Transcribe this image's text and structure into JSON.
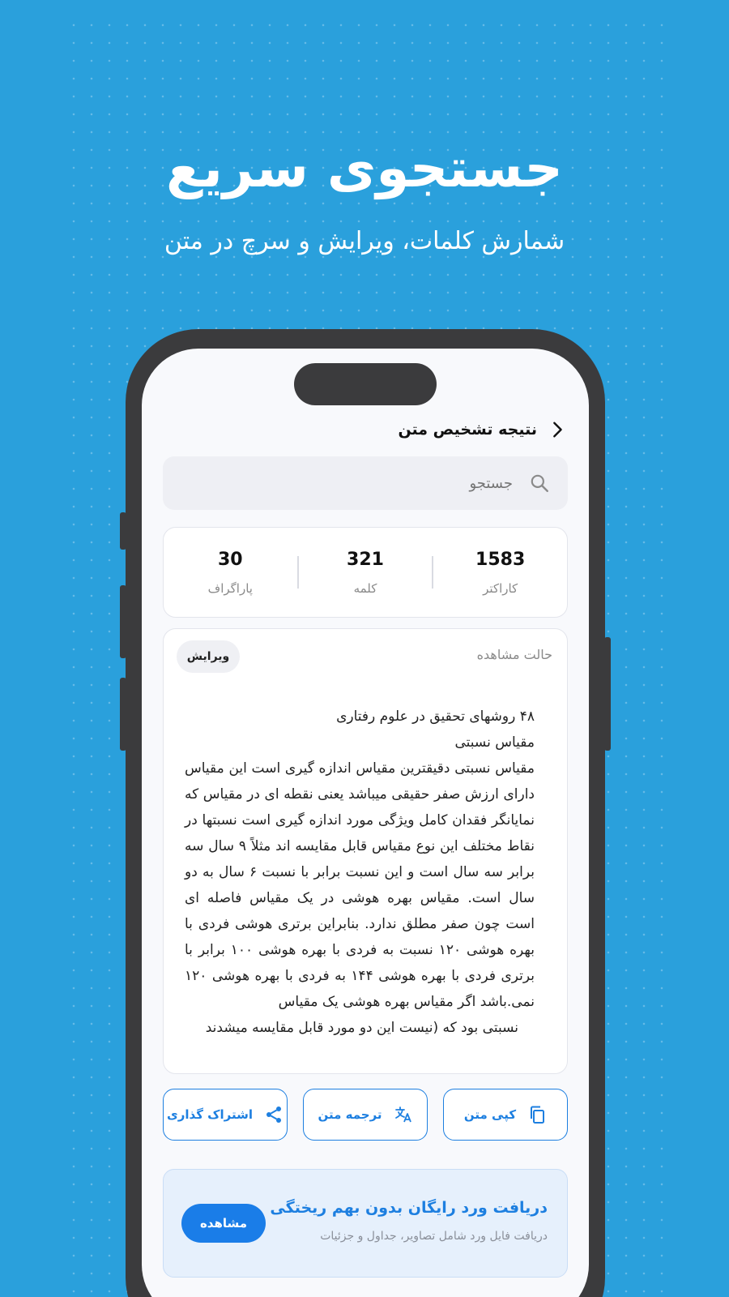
{
  "hero": {
    "title": "جستجوی سریع",
    "subtitle": "شمارش کلمات، ویرایش و سرچ در متن"
  },
  "header": {
    "back_icon": "chevron-right-icon",
    "title": "نتیجه تشخیص متن"
  },
  "search": {
    "placeholder": "جستجو",
    "icon": "search-icon"
  },
  "stats": [
    {
      "value": "1583",
      "label": "کاراکتر"
    },
    {
      "value": "321",
      "label": "کلمه"
    },
    {
      "value": "30",
      "label": "پاراگراف"
    }
  ],
  "text_card": {
    "mode_label": "حالت مشاهده",
    "edit_label": "ویرایش",
    "lines": [
      "۴۸ روشهای تحقیق در علوم رفتاری",
      "مقیاس نسبتی",
      "مقیاس نسبتی دقیقترین مقیاس اندازه گیری است این مقیاس دارای ارزش صفر حقیقی میباشد یعنی نقطه ای در مقیاس که نمایانگر فقدان کامل ویژگی مورد اندازه گیری است نسبتها در نقاط مختلف این نوع مقیاس قابل مقایسه اند مثلاً ۹ سال سه برابر سه سال است و این نسبت برابر با نسبت ۶ سال به دو سال است. مقیاس بهره هوشی در یک مقیاس فاصله ای است چون صفر مطلق ندارد. بنابراین برتری هوشی فردی با بهره هوشی ۱۲۰ نسبت به فردی با بهره هوشی ۱۰۰ برابر با برتری فردی با بهره هوشی ۱۴۴ به فردی با بهره هوشی ۱۲۰ نمی.باشد اگر مقیاس بهره هوشی یک مقیاس",
      "نسبتی بود که (نیست این دو مورد قابل مقایسه میشدند"
    ]
  },
  "actions": [
    {
      "label": "کپی متن",
      "icon": "copy-icon"
    },
    {
      "label": "ترجمه متن",
      "icon": "translate-icon"
    },
    {
      "label": "اشتراک گذاری",
      "icon": "share-icon"
    }
  ],
  "promo": {
    "title": "دریافت ورد رایگان بدون بهم ریختگی",
    "subtitle": "دریافت فایل ورد شامل تصاویر، جداول و جزئیات",
    "button_label": "مشاهده"
  },
  "colors": {
    "background": "#2aa0dc",
    "accent": "#1d7fe0",
    "phone_frame": "#3b3b3d"
  }
}
